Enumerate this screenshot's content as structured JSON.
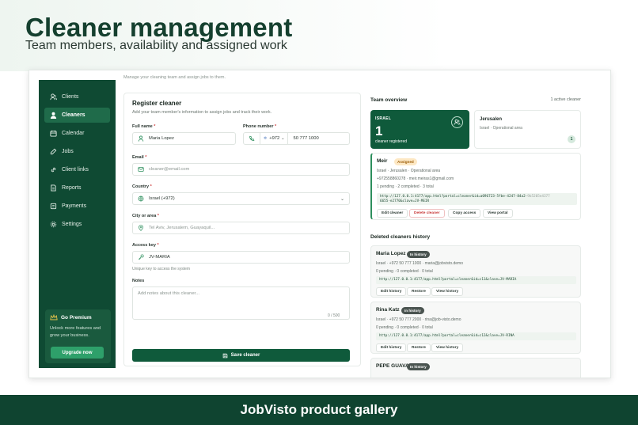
{
  "hero": {
    "title": "Cleaner management",
    "subtitle": "Team members, availability and assigned work"
  },
  "sidebar": {
    "items": [
      {
        "label": "Clients",
        "icon": "clients-icon"
      },
      {
        "label": "Cleaners",
        "icon": "cleaners-icon",
        "active": true
      },
      {
        "label": "Calendar",
        "icon": "calendar-icon"
      },
      {
        "label": "Jobs",
        "icon": "jobs-icon"
      },
      {
        "label": "Client links",
        "icon": "link-icon"
      },
      {
        "label": "Reports",
        "icon": "reports-icon"
      },
      {
        "label": "Payments",
        "icon": "payments-icon"
      },
      {
        "label": "Settings",
        "icon": "settings-icon"
      }
    ],
    "premium": {
      "title": "Go Premium",
      "description": "Unlock more features and grow your business.",
      "button": "Upgrade now"
    }
  },
  "top_hint": "Manage your cleaning team and assign jobs to them.",
  "form": {
    "title": "Register cleaner",
    "description": "Add your team member's information to assign jobs and track their work.",
    "full_name_label": "Full name",
    "full_name_value": "Maria Lopez",
    "phone_label": "Phone number",
    "phone_code": "+972",
    "phone_value": "50 777 1000",
    "email_label": "Email",
    "email_placeholder": "cleaner@email.com",
    "country_label": "Country",
    "country_value": "Israel (+972)",
    "city_label": "City or area",
    "city_placeholder": "Tel Aviv, Jerusalem, Guayaquil...",
    "access_key_label": "Access key",
    "access_key_value": "JV-MARIA",
    "access_key_hint": "Unique key to access the system",
    "notes_label": "Notes",
    "notes_placeholder": "Add notes about this cleaner...",
    "notes_counter": "0 / 500",
    "save_label": "Save cleaner"
  },
  "overview": {
    "title": "Team overview",
    "active_count": "1 active cleaner",
    "stat": {
      "country": "ISRAEL",
      "number": "1",
      "caption": "cleaner registered"
    },
    "city": {
      "name": "Jerusalen",
      "subtitle": "Israel · Operational area",
      "count": "1"
    }
  },
  "member": {
    "name": "Meir",
    "tag": "Assigned",
    "location": "Israel · Jerusalen · Operational area",
    "contact": "+972558860278 · meir.meiras1@gmail.com",
    "stats": "1 pending · 2 completed · 3 total",
    "link_main": "http://127.0.0.1:4177/app.html?portal=cleaner&id=a096723-5fbe-4247-84a2-",
    "link_dim": "9b5205e4377",
    "link_tail": "6655-e2770&clave=JV-MEIR",
    "actions": [
      "Edit cleaner",
      "Delete cleaner",
      "Copy access",
      "View portal"
    ]
  },
  "history": {
    "title": "Deleted cleaners history",
    "items": [
      {
        "name": "Maria Lopez",
        "tag": "In history",
        "contact": "Israel · +972 50 777 1000 · maria@jobvisto.demo",
        "stats": "0 pending · 0 completed · 0 total",
        "link": "http://127.0.0.1:4177/app.html?portal=cleaner&id=c11&clave=JV-MARIA",
        "actions": [
          "Edit history",
          "Restore",
          "View history"
        ]
      },
      {
        "name": "Rina Katz",
        "tag": "In history",
        "contact": "Israel · +972 50 777 2000 · rina@job-visto.demo",
        "stats": "0 pending · 0 completed · 0 total",
        "link": "http://127.0.0.1:4177/app.html?portal=cleaner&id=c12&clave=JV-RINA",
        "actions": [
          "Edit history",
          "Restore",
          "View history"
        ]
      },
      {
        "name": "PEPE GUAVA",
        "tag": "In history"
      }
    ]
  },
  "footer": {
    "text": "JobVisto product gallery"
  },
  "colors": {
    "brand_dark": "#0f4a33",
    "brand": "#0f5a3b",
    "accent": "#2ea06a",
    "danger": "#c83a3a"
  }
}
